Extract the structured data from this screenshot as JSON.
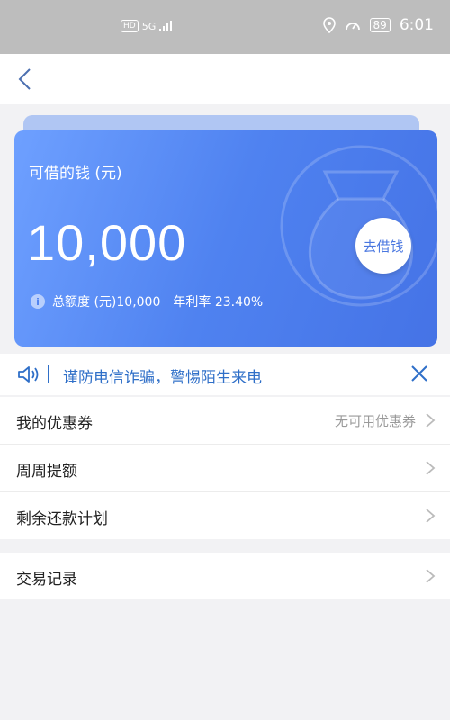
{
  "status_bar": {
    "hd": "HD",
    "network": "5G",
    "battery": "89",
    "time": "6:01"
  },
  "card": {
    "label": "可借的钱 (元)",
    "amount": "10,000",
    "borrow_button": "去借钱",
    "total_limit": "总额度 (元)10,000",
    "annual_rate": "年利率 23.40%"
  },
  "notice": {
    "text": "谨防电信诈骗，警惕陌生来电"
  },
  "menu": [
    {
      "label": "我的优惠券",
      "value": "无可用优惠券"
    },
    {
      "label": "周周提额"
    },
    {
      "label": "剩余还款计划"
    }
  ],
  "menu2": [
    {
      "label": "交易记录"
    }
  ],
  "colors": {
    "card_start": "#6ea0ff",
    "card_end": "#4573e6",
    "link_blue": "#2f6fc8"
  }
}
